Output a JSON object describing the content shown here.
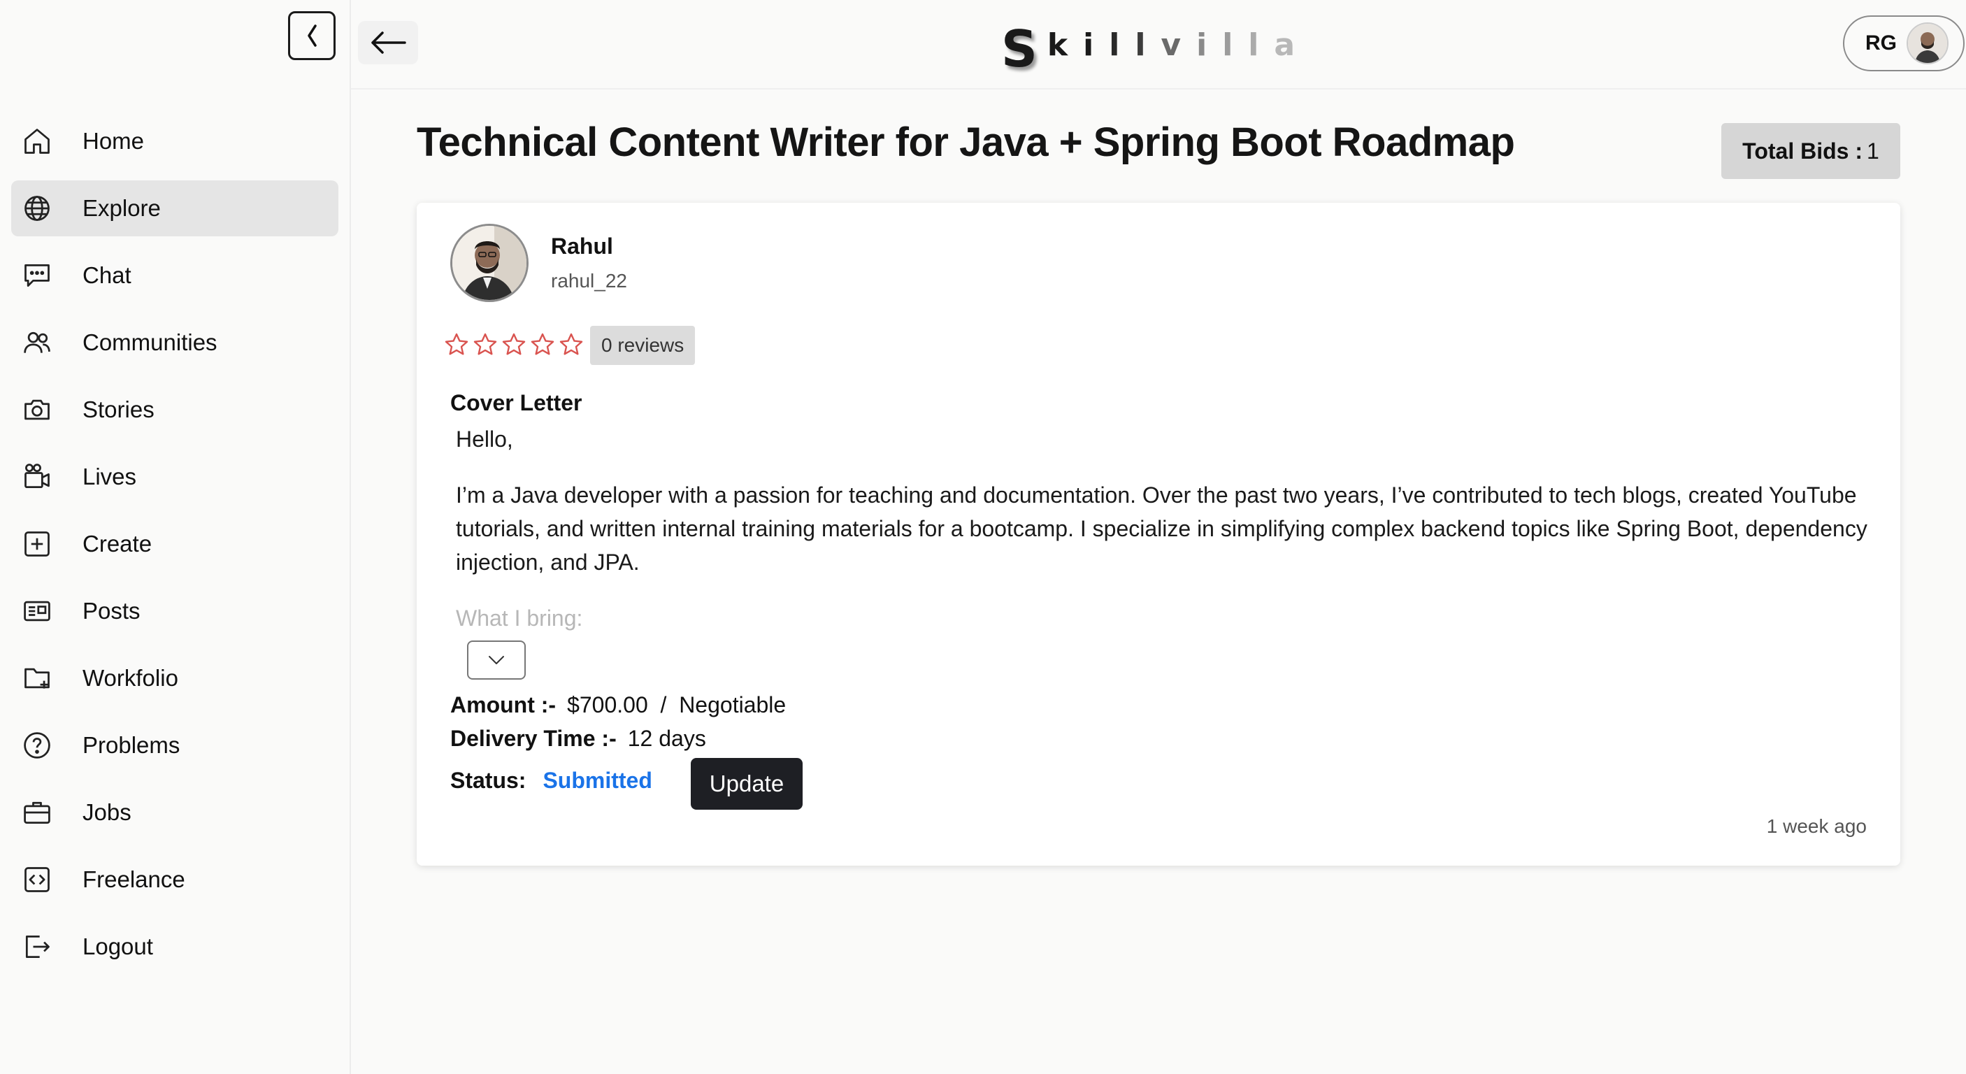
{
  "sidebar": {
    "items": [
      {
        "label": "Home",
        "icon": "home-icon",
        "active": false
      },
      {
        "label": "Explore",
        "icon": "globe-icon",
        "active": true
      },
      {
        "label": "Chat",
        "icon": "chat-icon",
        "active": false
      },
      {
        "label": "Communities",
        "icon": "users-icon",
        "active": false
      },
      {
        "label": "Stories",
        "icon": "camera-icon",
        "active": false
      },
      {
        "label": "Lives",
        "icon": "video-icon",
        "active": false
      },
      {
        "label": "Create",
        "icon": "plus-square-icon",
        "active": false
      },
      {
        "label": "Posts",
        "icon": "newspaper-icon",
        "active": false
      },
      {
        "label": "Workfolio",
        "icon": "folder-plus-icon",
        "active": false
      },
      {
        "label": "Problems",
        "icon": "question-circle-icon",
        "active": false
      },
      {
        "label": "Jobs",
        "icon": "briefcase-icon",
        "active": false
      },
      {
        "label": "Freelance",
        "icon": "code-square-icon",
        "active": false
      },
      {
        "label": "Logout",
        "icon": "logout-icon",
        "active": false
      }
    ]
  },
  "header": {
    "logo_first": "S",
    "logo_rest": [
      "k",
      "i",
      "l",
      "l",
      "v",
      "i",
      "l",
      "l",
      "a"
    ],
    "profile_initials": "RG"
  },
  "main": {
    "title": "Technical Content Writer for Java + Spring Boot Roadmap",
    "total_bids_label": "Total Bids :",
    "total_bids_value": "1"
  },
  "bid": {
    "name": "Rahul",
    "username": "rahul_22",
    "rating": 0,
    "reviews_label": "0 reviews",
    "cover_letter_heading": "Cover Letter",
    "greeting": "Hello,",
    "paragraph": "I’m a Java developer with a passion for teaching and documentation. Over the past two years, I’ve contributed to tech blogs, created YouTube tutorials, and written internal training materials for a bootcamp. I specialize in simplifying complex backend topics like Spring Boot, dependency injection, and JPA.",
    "faded_line": "What I bring:",
    "amount_label": "Amount :-",
    "amount_value": "$700.00  /  Negotiable",
    "delivery_label": "Delivery Time :-",
    "delivery_value": "12 days",
    "status_label": "Status:",
    "status_value": "Submitted",
    "update_label": "Update",
    "posted": "1 week ago"
  },
  "colors": {
    "accent_blue": "#1a73e8",
    "star_red": "#d9534f",
    "button_dark": "#1e1f24"
  }
}
